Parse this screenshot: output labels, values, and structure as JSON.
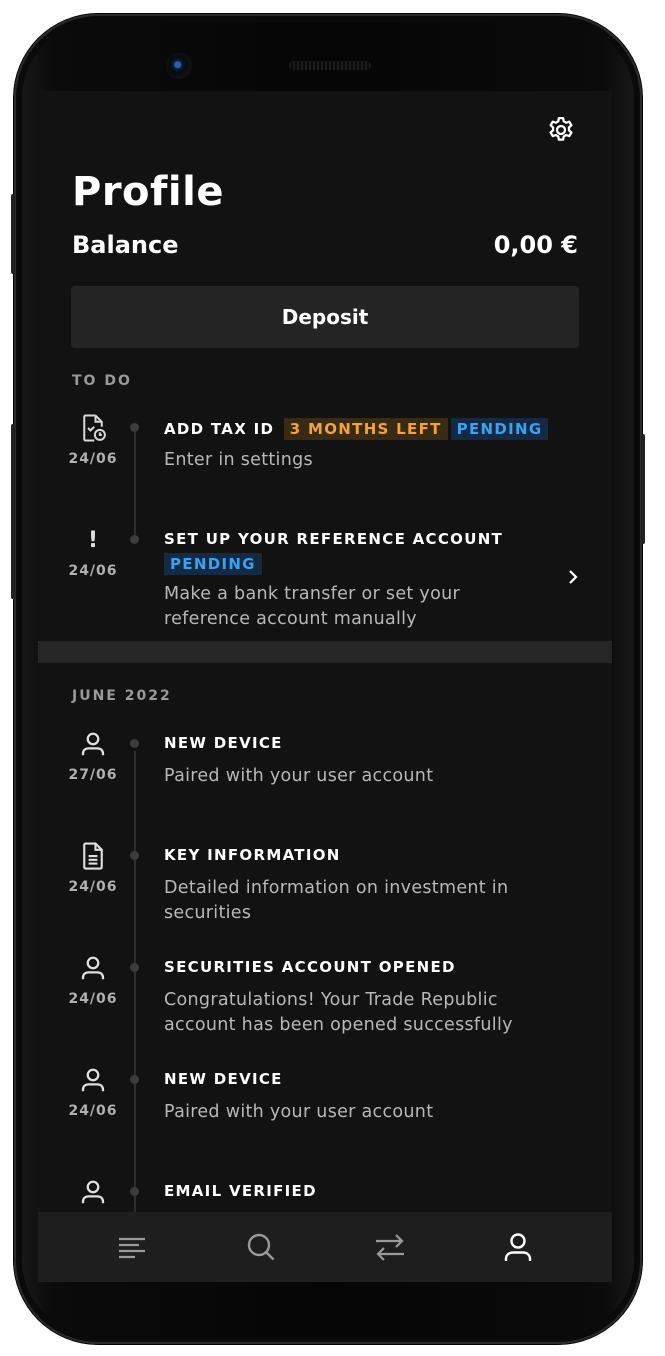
{
  "header": {
    "settings_icon": "gear-icon",
    "title": "Profile"
  },
  "balance": {
    "label": "Balance",
    "value": "0,00 €"
  },
  "deposit_label": "Deposit",
  "todo": {
    "section_label": "TO DO",
    "items": [
      {
        "icon": "document-clock-icon",
        "date": "24/06",
        "title": "ADD TAX ID",
        "badges": [
          {
            "label": "3 MONTHS LEFT",
            "color": "#f4a33c"
          },
          {
            "label": "PENDING",
            "color": "#3aa2f2"
          }
        ],
        "description": "Enter in settings"
      },
      {
        "icon": "exclamation-icon",
        "icon_text": "!",
        "date": "24/06",
        "title": "SET UP YOUR REFERENCE ACCOUNT",
        "badges": [
          {
            "label": "PENDING",
            "color": "#3aa2f2"
          }
        ],
        "description": "Make a bank transfer or set your reference account manually"
      }
    ]
  },
  "timeline": {
    "section_label": "JUNE 2022",
    "items": [
      {
        "icon": "user-icon",
        "date": "27/06",
        "title": "NEW DEVICE",
        "description": "Paired with your user account"
      },
      {
        "icon": "document-icon",
        "date": "24/06",
        "title": "KEY INFORMATION",
        "description": "Detailed information on investment in securities"
      },
      {
        "icon": "user-icon",
        "date": "24/06",
        "title": "SECURITIES ACCOUNT OPENED",
        "description": "Congratulations! Your Trade Republic account has been opened successfully"
      },
      {
        "icon": "user-icon",
        "date": "24/06",
        "title": "NEW DEVICE",
        "description": "Paired with your user account"
      },
      {
        "icon": "user-icon",
        "date": "",
        "title": "EMAIL VERIFIED",
        "description": ""
      }
    ]
  },
  "tabbar": {
    "tabs": [
      {
        "icon": "menu-lines-icon",
        "active": false
      },
      {
        "icon": "search-icon",
        "active": false
      },
      {
        "icon": "transfer-arrows-icon",
        "active": false
      },
      {
        "icon": "user-icon",
        "active": true
      }
    ]
  },
  "colors": {
    "background": "#121212",
    "surface": "#242424",
    "accent_orange": "#f4a33c",
    "accent_blue": "#3aa2f2"
  }
}
